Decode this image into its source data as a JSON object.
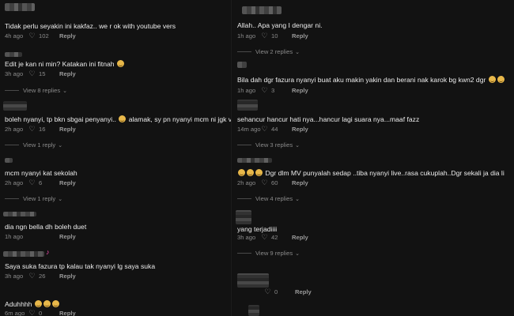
{
  "left": [
    {
      "name_label": "",
      "text": "Tidak perlu seyakin ini kakfaz.. we r ok with youtube vers",
      "emoji_count": 0,
      "time": "4h ago",
      "likes": "102",
      "reply": "Reply",
      "view": ""
    },
    {
      "name_label": "",
      "text": "Edit je kan ni min? Katakan ini fitnah",
      "emoji_count": 1,
      "time": "3h ago",
      "likes": "15",
      "reply": "Reply",
      "view": "View 8 replies"
    },
    {
      "name_label": "",
      "text": "boleh nyanyi, tp bkn sbgai penyanyi..",
      "text_b": "alamak, sy pn nyanyi mcm ni jgk v",
      "emoji_count": 1,
      "time": "2h ago",
      "likes": "16",
      "reply": "Reply",
      "view": "View 1 reply"
    },
    {
      "name_label": "",
      "text": "mcm nyanyi kat sekolah",
      "emoji_count": 0,
      "time": "2h ago",
      "likes": "6",
      "reply": "Reply",
      "view": "View 1 reply"
    },
    {
      "name_label": "",
      "text": "dia ngn bella dh boleh duet",
      "emoji_count": 0,
      "time": "1h ago",
      "likes": "",
      "reply": "Reply",
      "view": ""
    },
    {
      "name_label": "",
      "text": "Saya suka fazura tp kalau tak nyanyi lg saya suka",
      "emoji_count": 0,
      "time": "3h ago",
      "likes": "26",
      "reply": "Reply",
      "view": ""
    },
    {
      "name_label": "",
      "text": "Aduhhhh",
      "emoji_count": 3,
      "time": "6m ago",
      "likes": "0",
      "reply": "Reply",
      "view": ""
    }
  ],
  "right": [
    {
      "text": "Allah.. Apa yang I dengar ni.",
      "emoji_count": 0,
      "time": "1h ago",
      "likes": "10",
      "reply": "Reply",
      "view": "View 2 replies"
    },
    {
      "text": "Bila dah dgr fazura nyanyi buat aku makin yakin dan berani nak karok bg kwn2 dgr",
      "emoji_count": 2,
      "time": "1h ago",
      "likes": "3",
      "reply": "Reply",
      "view": ""
    },
    {
      "text": "sehancur hancur hati nya...hancur lagi suara nya...maaf fazz",
      "emoji_count": 0,
      "time": "14m ago",
      "likes": "44",
      "reply": "Reply",
      "view": "View 3 replies"
    },
    {
      "text": "Dgr dlm MV punyalah sedap ..tiba nyanyi live..rasa cukuplah..Dgr sekali ja dia li",
      "emoji_count": 3,
      "time": "2h ago",
      "likes": "60",
      "reply": "Reply",
      "view": "View 4 replies"
    },
    {
      "text": "yang terjadiiii",
      "emoji_count": 0,
      "time": "3h ago",
      "likes": "42",
      "reply": "Reply",
      "view": "View 9 replies"
    },
    {
      "text": "",
      "emoji_count": 0,
      "time": "",
      "likes": "0",
      "reply": "Reply",
      "view": ""
    }
  ],
  "icons": {
    "heart": "heart-outline-icon",
    "chevron": "chevron-down-icon",
    "emoji": "laughing-face-icon",
    "music_note": "music-note-icon"
  }
}
